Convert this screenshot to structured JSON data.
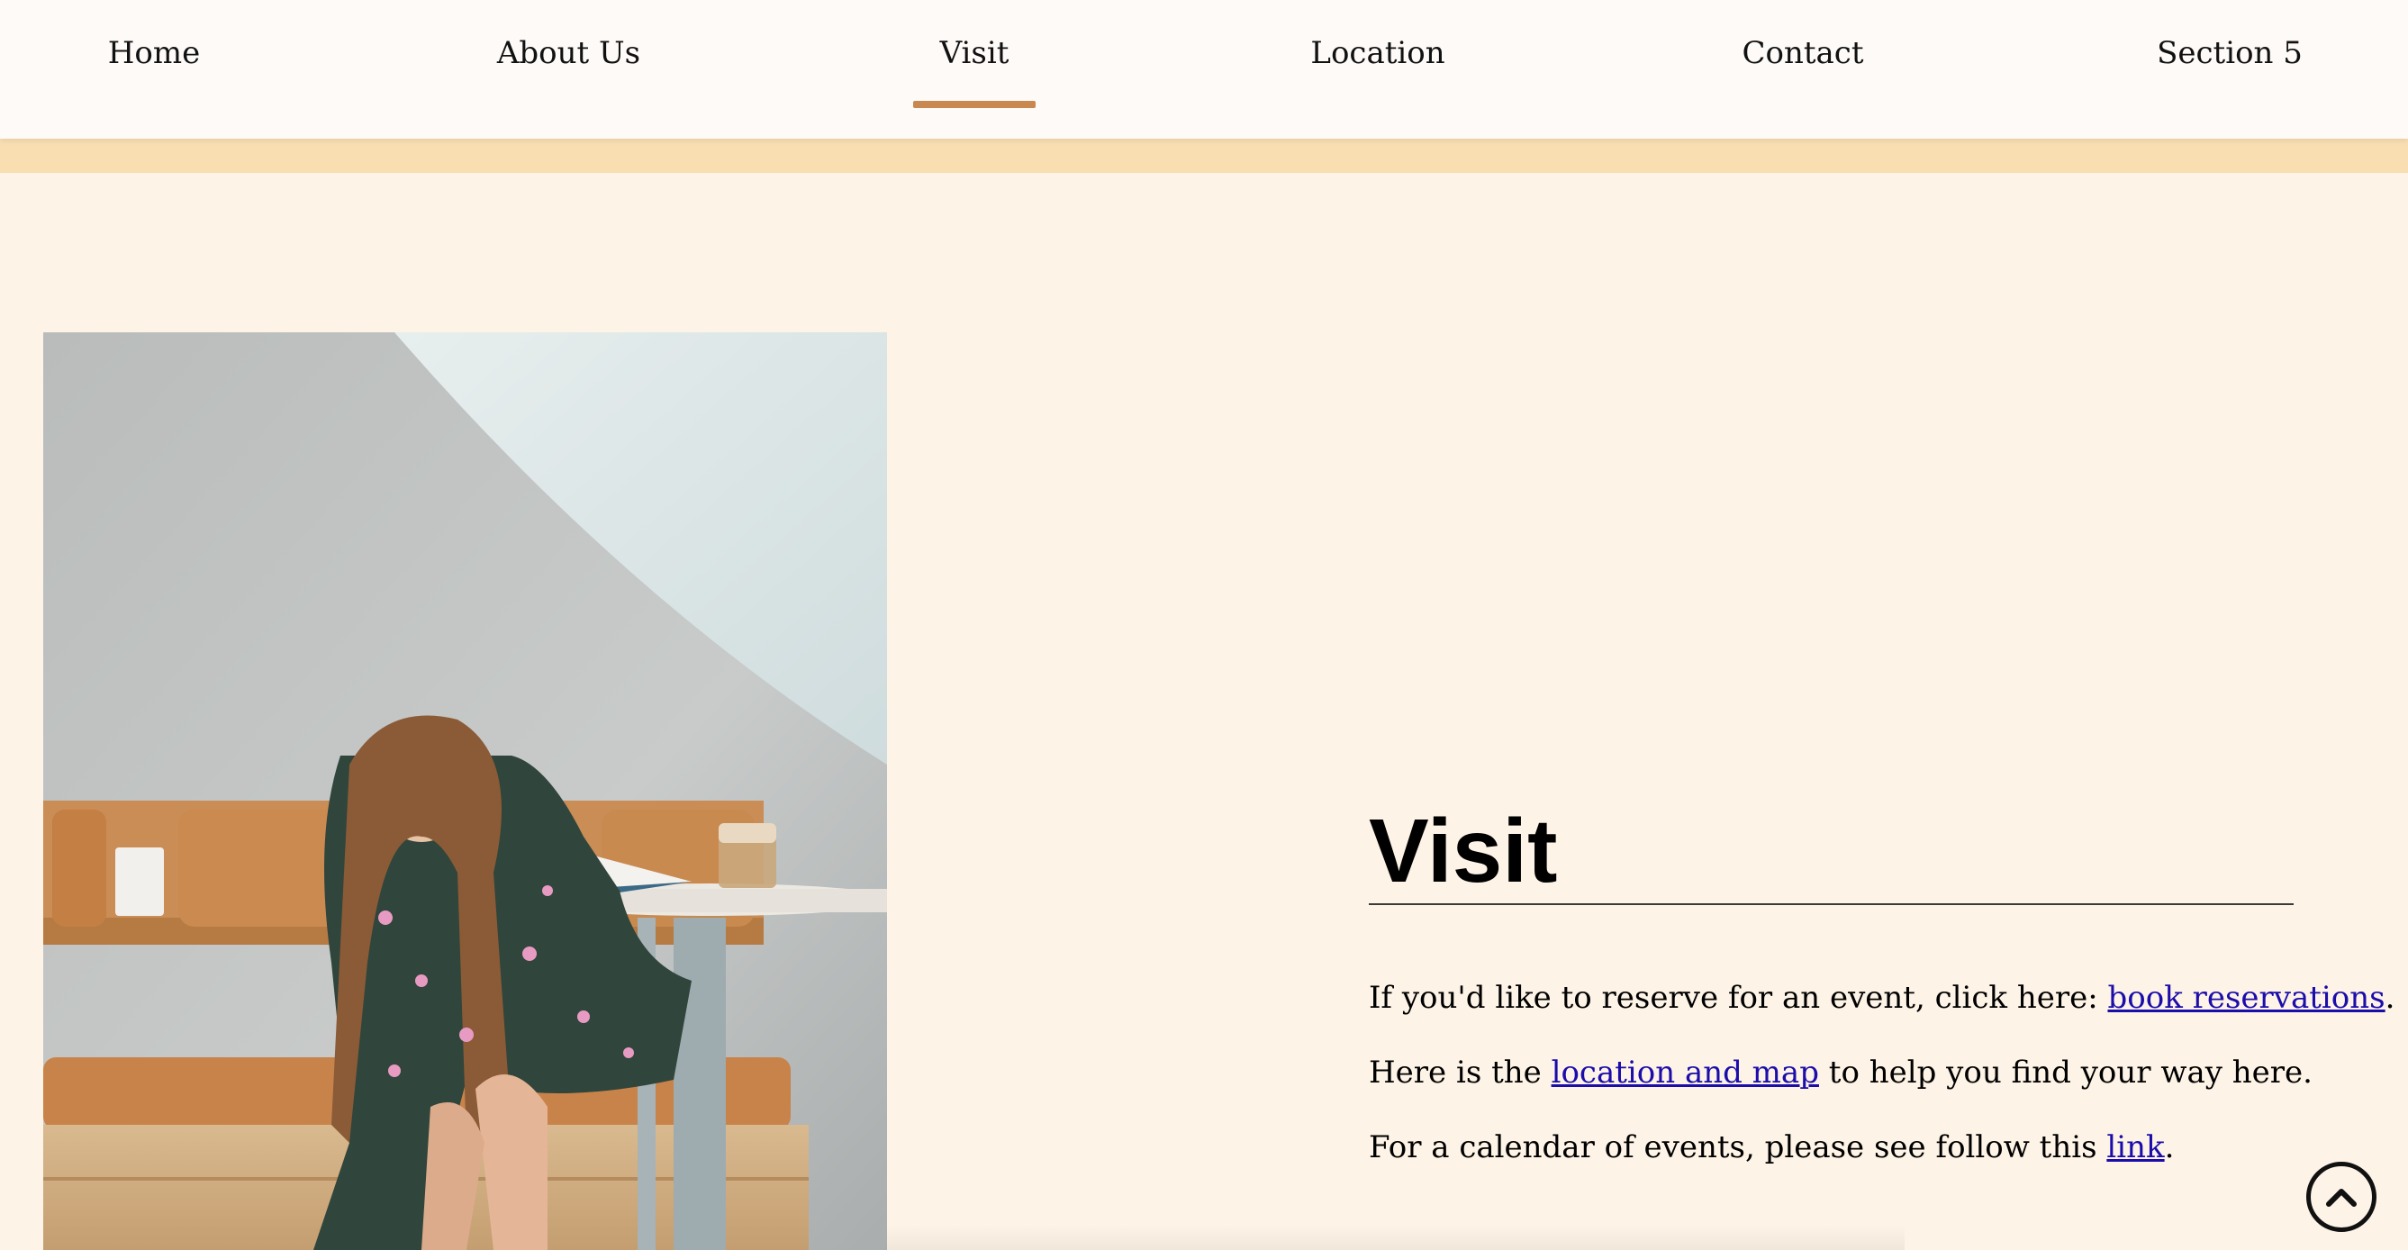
{
  "nav": {
    "items": [
      {
        "label": "Home",
        "active": false
      },
      {
        "label": "About Us",
        "active": false
      },
      {
        "label": "Visit",
        "active": true
      },
      {
        "label": "Location",
        "active": false
      },
      {
        "label": "Contact",
        "active": false
      },
      {
        "label": "Section 5",
        "active": false
      }
    ],
    "accent_color": "#c8884f"
  },
  "colors": {
    "background": "#fdf3e6",
    "band": "#f8deb0",
    "link": "#1a0dab"
  },
  "section": {
    "title": "Visit",
    "paragraphs": [
      {
        "before": "If you'd like to reserve for an event, click here: ",
        "link": "book reservations",
        "after": "."
      },
      {
        "before": "Here is the ",
        "link": "location and map",
        "after": " to help you find your way here."
      },
      {
        "before": "For a calendar of events, please see follow this ",
        "link": "link",
        "after": "."
      }
    ]
  },
  "icons": {
    "scroll_top": "chevron-up-circle-icon"
  }
}
